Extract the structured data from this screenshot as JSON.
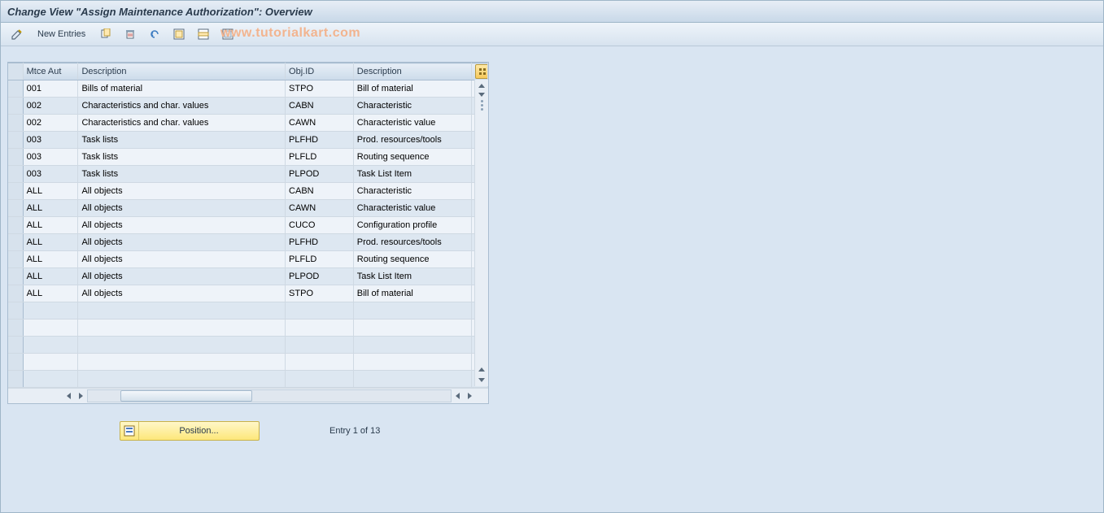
{
  "title": "Change View \"Assign Maintenance Authorization\": Overview",
  "toolbar": {
    "new_entries": "New Entries"
  },
  "watermark": "www.tutorialkart.com",
  "columns": {
    "mtce": "Mtce Aut",
    "desc1": "Description",
    "obj": "Obj.ID",
    "desc2": "Description"
  },
  "rows": [
    {
      "mtce": "001",
      "desc1": "Bills of material",
      "obj": "STPO",
      "desc2": "Bill of material"
    },
    {
      "mtce": "002",
      "desc1": "Characteristics and char. values",
      "obj": "CABN",
      "desc2": "Characteristic"
    },
    {
      "mtce": "002",
      "desc1": "Characteristics and char. values",
      "obj": "CAWN",
      "desc2": "Characteristic value"
    },
    {
      "mtce": "003",
      "desc1": "Task lists",
      "obj": "PLFHD",
      "desc2": "Prod. resources/tools"
    },
    {
      "mtce": "003",
      "desc1": "Task lists",
      "obj": "PLFLD",
      "desc2": "Routing sequence"
    },
    {
      "mtce": "003",
      "desc1": "Task lists",
      "obj": "PLPOD",
      "desc2": "Task List Item"
    },
    {
      "mtce": "ALL",
      "desc1": "All objects",
      "obj": "CABN",
      "desc2": "Characteristic"
    },
    {
      "mtce": "ALL",
      "desc1": "All objects",
      "obj": "CAWN",
      "desc2": "Characteristic value"
    },
    {
      "mtce": "ALL",
      "desc1": "All objects",
      "obj": "CUCO",
      "desc2": "Configuration profile"
    },
    {
      "mtce": "ALL",
      "desc1": "All objects",
      "obj": "PLFHD",
      "desc2": "Prod. resources/tools"
    },
    {
      "mtce": "ALL",
      "desc1": "All objects",
      "obj": "PLFLD",
      "desc2": "Routing sequence"
    },
    {
      "mtce": "ALL",
      "desc1": "All objects",
      "obj": "PLPOD",
      "desc2": "Task List Item"
    },
    {
      "mtce": "ALL",
      "desc1": "All objects",
      "obj": "STPO",
      "desc2": "Bill of material"
    }
  ],
  "empty_rows": 5,
  "footer": {
    "position_btn": "Position...",
    "entry_text": "Entry 1 of 13"
  }
}
